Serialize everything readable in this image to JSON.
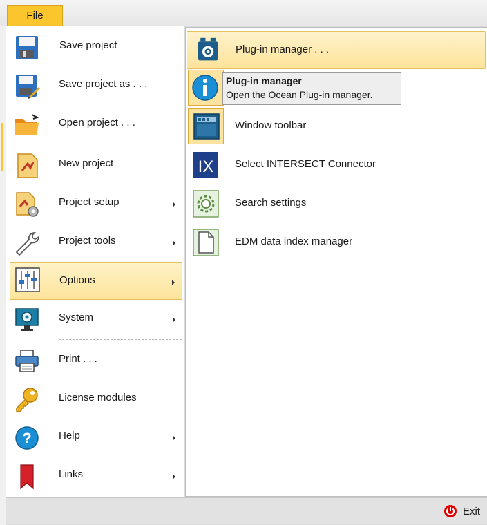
{
  "ribbon": {
    "file_tab": "File"
  },
  "menu": {
    "items": [
      {
        "label": "Save project",
        "icon": "save-icon"
      },
      {
        "label": "Save project as . . .",
        "icon": "save-as-icon"
      },
      {
        "label": "Open project . . .",
        "icon": "open-folder-icon"
      },
      {
        "label": "New project",
        "icon": "new-project-icon"
      },
      {
        "label": "Project setup",
        "icon": "project-setup-icon",
        "submenu": true
      },
      {
        "label": "Project tools",
        "icon": "wrench-icon",
        "submenu": true
      },
      {
        "label": "Options",
        "icon": "sliders-icon",
        "submenu": true,
        "selected": true
      },
      {
        "label": "System",
        "icon": "monitor-gear-icon",
        "submenu": true
      },
      {
        "label": "Print . . .",
        "icon": "printer-icon"
      },
      {
        "label": "License modules",
        "icon": "key-icon"
      },
      {
        "label": "Help",
        "icon": "help-icon",
        "submenu": true
      },
      {
        "label": "Links",
        "icon": "bookmark-icon",
        "submenu": true
      }
    ]
  },
  "options_panel": {
    "items": [
      {
        "label": "Plug-in manager . . .",
        "icon": "plugin-manager-icon",
        "selected": true
      },
      {
        "label": "Window toolbar",
        "icon": "window-toolbar-icon"
      },
      {
        "label": "Select INTERSECT Connector",
        "icon": "intersect-icon",
        "icon_text": "IX"
      },
      {
        "label": "Search settings",
        "icon": "search-settings-icon"
      },
      {
        "label": "EDM data index manager",
        "icon": "document-icon"
      }
    ]
  },
  "tooltip": {
    "title": "Plug-in manager",
    "description": "Open the Ocean Plug-in manager."
  },
  "footer": {
    "exit_label": "Exit"
  },
  "colors": {
    "accent": "#fbc52d",
    "selection": "#fde49b",
    "exit_red": "#e00000"
  }
}
